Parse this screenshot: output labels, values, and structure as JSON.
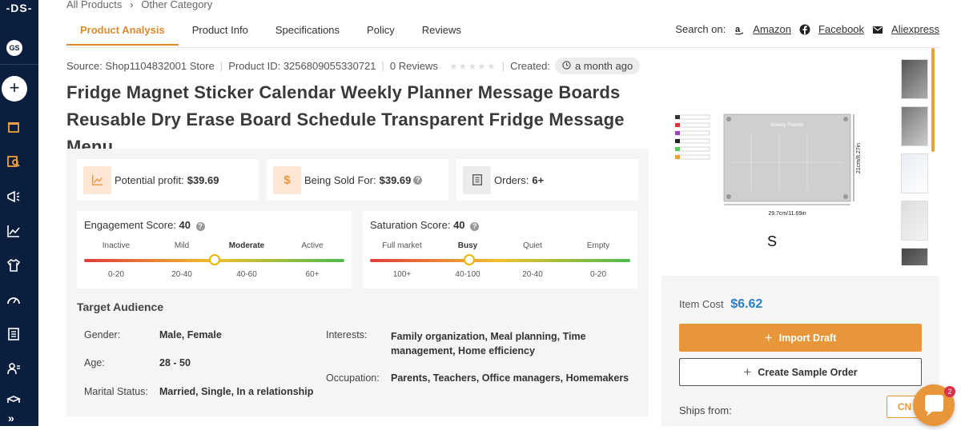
{
  "sidebar": {
    "logo": "-DS-",
    "avatar_initials": "GS",
    "add_label": "+",
    "icons": [
      "store-icon",
      "product-search-icon",
      "megaphone-icon",
      "chart-icon",
      "shirt-icon",
      "speedometer-icon",
      "document-icon",
      "user-card-icon",
      "box-icon"
    ],
    "expand_label": "»"
  },
  "breadcrumb": {
    "items": [
      "All Products",
      "Other Category"
    ],
    "separator": "›"
  },
  "tabs": [
    "Product Analysis",
    "Product Info",
    "Specifications",
    "Policy",
    "Reviews"
  ],
  "active_tab": "Product Analysis",
  "search_on": {
    "label": "Search on:",
    "links": [
      "Amazon",
      "Facebook",
      "Aliexpress"
    ]
  },
  "meta": {
    "source": "Source: Shop1104832001 Store",
    "product_id": "Product ID: 3256809055330721",
    "reviews": "0 Reviews",
    "stars": "★★★★★",
    "created_label": "Created:",
    "created_value": "a month ago"
  },
  "title": "Fridge Magnet Sticker Calendar Weekly Planner Message Boards Reusable Dry Erase Board Schedule Transparent Fridge Message Menu",
  "cards": {
    "profit_label": "Potential profit:",
    "profit_value": "$39.69",
    "sold_label": "Being Sold For:",
    "sold_value": "$39.69",
    "orders_label": "Orders:",
    "orders_value": "6+"
  },
  "engagement": {
    "label": "Engagement Score:",
    "value": "40",
    "levels": [
      "Inactive",
      "Mild",
      "Moderate",
      "Active"
    ],
    "active_level": "Moderate",
    "ranges": [
      "0-20",
      "20-40",
      "40-60",
      "60+"
    ],
    "score_fraction": 0.5
  },
  "saturation": {
    "label": "Saturation Score:",
    "value": "40",
    "levels": [
      "Full market",
      "Busy",
      "Quiet",
      "Empty"
    ],
    "active_level": "Busy",
    "ranges": [
      "100+",
      "40-100",
      "20-40",
      "0-20"
    ],
    "score_fraction": 0.38
  },
  "target_audience": {
    "title": "Target Audience",
    "gender_label": "Gender:",
    "gender_value": "Male, Female",
    "age_label": "Age:",
    "age_value": "28 - 50",
    "marital_label": "Marital Status:",
    "marital_value": "Married, Single, In a relationship",
    "interests_label": "Interests:",
    "interests_value": "Family organization, Meal planning, Time management, Home efficiency",
    "occupation_label": "Occupation:",
    "occupation_value": "Parents, Teachers, Office managers, Homemakers"
  },
  "product_image": {
    "height_label": "21cm/8.27in",
    "width_label": "29.7cm/11.69in",
    "size_label": "S",
    "board_title": "Weekly Planner"
  },
  "purchase": {
    "item_cost_label": "Item Cost",
    "item_cost_value": "$6.62",
    "import_label": "Import Draft",
    "sample_label": "Create Sample Order",
    "ships_label": "Ships from:",
    "ships_value": "CN"
  },
  "chat": {
    "badge": "2"
  },
  "colors": {
    "accent": "#e8963a",
    "sidebar": "#0b1e3d",
    "price": "#2a7fc9"
  }
}
